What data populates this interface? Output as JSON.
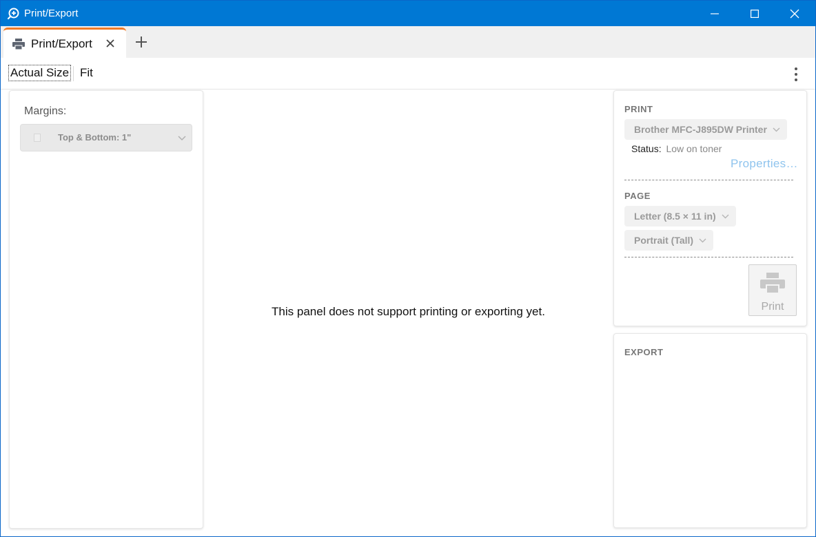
{
  "window": {
    "title": "Print/Export"
  },
  "tabs": [
    {
      "label": "Print/Export",
      "icon": "printer-icon",
      "active": true
    }
  ],
  "toolbar": {
    "actual_size_label": "Actual Size",
    "fit_label": "Fit"
  },
  "left_panel": {
    "margins_label": "Margins:",
    "margins_value": "Top & Bottom:  1\""
  },
  "center": {
    "message": "This panel does not support printing or exporting yet."
  },
  "print_section": {
    "title": "PRINT",
    "printer": "Brother MFC-J895DW Printer",
    "status_label": "Status:",
    "status_value": "Low on toner",
    "properties_link": "Properties…"
  },
  "page_section": {
    "title": "PAGE",
    "paper_size": "Letter (8.5 × 11 in)",
    "orientation": "Portrait (Tall)",
    "print_button_label": "Print"
  },
  "export_section": {
    "title": "EXPORT"
  },
  "colors": {
    "titlebar": "#0078d4",
    "tab_accent": "#f07a26",
    "link_disabled": "#8fc4ee"
  }
}
